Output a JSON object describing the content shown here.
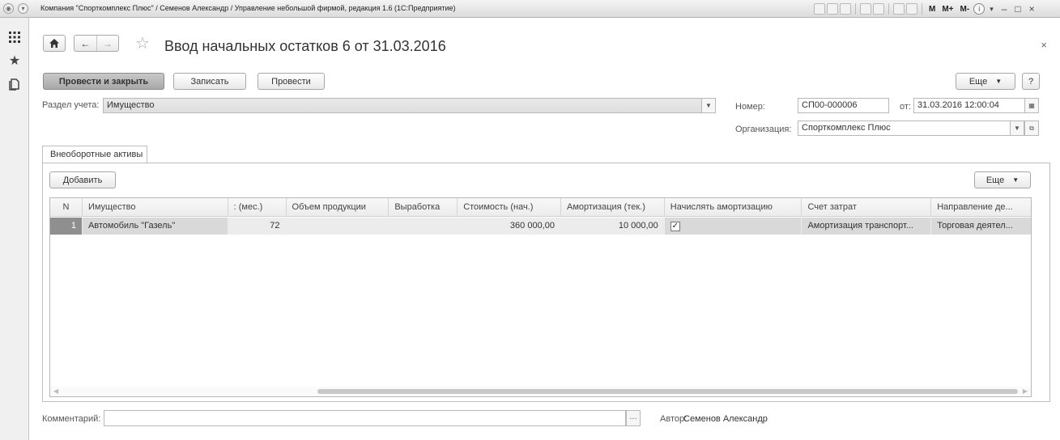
{
  "window": {
    "title": "Компания \"Спорткомплекс Плюс\" / Семенов Александр / Управление небольшой фирмой, редакция 1.6  (1С:Предприятие)",
    "m_labels": [
      "M",
      "M+",
      "M-"
    ],
    "info": "i"
  },
  "nav": {
    "back": "←",
    "forward": "→"
  },
  "page": {
    "title": "Ввод начальных остатков 6 от 31.03.2016",
    "close": "×"
  },
  "toolbar": {
    "post_close": "Провести и закрыть",
    "save": "Записать",
    "post": "Провести",
    "more": "Еще",
    "help": "?"
  },
  "form": {
    "section_label": "Раздел учета:",
    "section_value": "Имущество",
    "number_label": "Номер:",
    "number_value": "СП00-000006",
    "date_label": "от:",
    "date_value": "31.03.2016 12:00:04",
    "org_label": "Организация:",
    "org_value": "Спорткомплекс Плюс"
  },
  "tabs": [
    {
      "label": "Внеоборотные активы"
    }
  ],
  "table_toolbar": {
    "add": "Добавить",
    "more": "Еще"
  },
  "table": {
    "columns": [
      "N",
      "Имущество",
      ": (мес.)",
      "Объем продукции",
      "Выработка",
      "Стоимость (нач.)",
      "Амортизация (тек.)",
      "Начислять амортизацию",
      "Счет затрат",
      "Направление де..."
    ],
    "rows": [
      {
        "n": "1",
        "asset": "Автомобиль \"Газель\"",
        "months": "72",
        "volume": "",
        "output": "",
        "cost": "360 000,00",
        "amort": "10 000,00",
        "accrue": "✓",
        "account": "Амортизация транспорт...",
        "direction": "Торговая деятел..."
      }
    ]
  },
  "footer": {
    "comment_label": "Комментарий:",
    "comment_value": "",
    "author_label": "Автор:",
    "author_value": "Семенов Александр"
  }
}
